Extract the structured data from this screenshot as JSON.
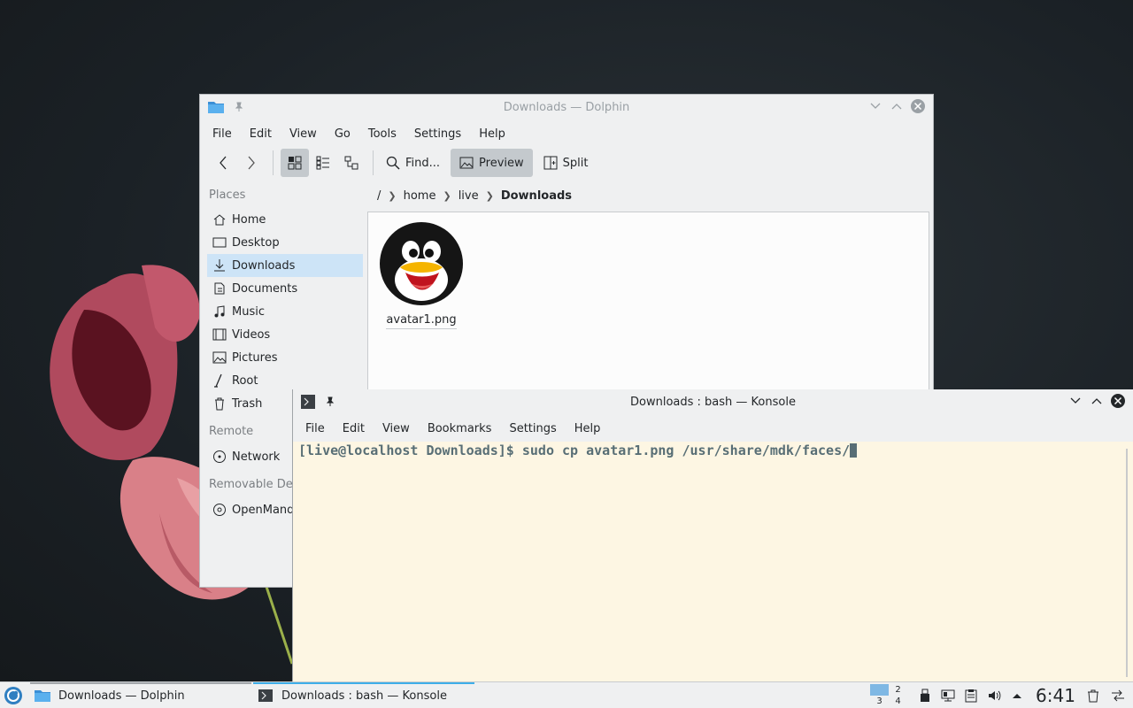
{
  "dolphin": {
    "title": "Downloads — Dolphin",
    "menu": [
      "File",
      "Edit",
      "View",
      "Go",
      "Tools",
      "Settings",
      "Help"
    ],
    "toolbar": {
      "find_label": "Find...",
      "preview_label": "Preview",
      "split_label": "Split",
      "active_view": "icons"
    },
    "places": {
      "heading": "Places",
      "items": [
        "Home",
        "Desktop",
        "Downloads",
        "Documents",
        "Music",
        "Videos",
        "Pictures",
        "Root",
        "Trash"
      ],
      "selected": "Downloads",
      "remote_heading": "Remote",
      "remote_items": [
        "Network"
      ],
      "removable_heading": "Removable Dev",
      "removable_items": [
        "OpenMand"
      ]
    },
    "breadcrumb": [
      "/",
      "home",
      "live",
      "Downloads"
    ],
    "files": [
      {
        "name": "avatar1.png",
        "icon": "tux-penguin-icon"
      }
    ]
  },
  "konsole": {
    "title": "Downloads : bash — Konsole",
    "menu": [
      "File",
      "Edit",
      "View",
      "Bookmarks",
      "Settings",
      "Help"
    ],
    "prompt": "[live@localhost Downloads]$ ",
    "command": "sudo cp avatar1.png /usr/share/mdk/faces/"
  },
  "taskbar": {
    "tasks": [
      {
        "label": "Downloads — Dolphin",
        "icon": "folder-icon"
      },
      {
        "label": "Downloads : bash — Konsole",
        "icon": "terminal-icon"
      }
    ],
    "pager": [
      "",
      "2",
      "3",
      "4"
    ],
    "clock": "6:41"
  },
  "colors": {
    "selection": "#cde4f7",
    "accent": "#3daee9",
    "terminal_bg": "#fdf6e3",
    "terminal_fg": "#586e75"
  }
}
